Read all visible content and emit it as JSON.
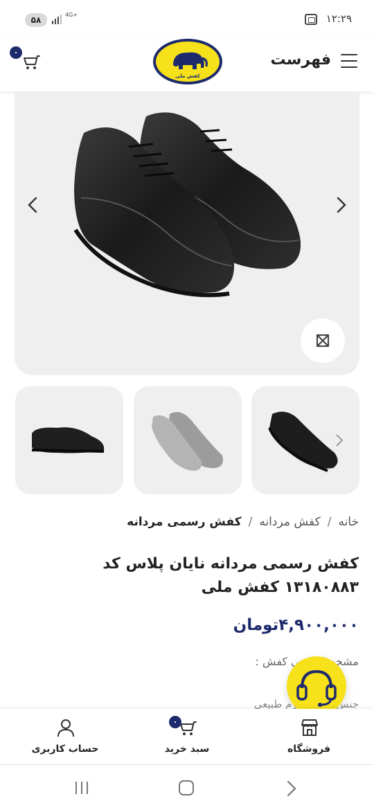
{
  "status_bar": {
    "time": "۱۲:۲۹",
    "battery": "۵۸",
    "network": "4G+"
  },
  "header": {
    "menu_label": "فهرست",
    "cart_count": "۰",
    "logo_text": "کفش ملی"
  },
  "breadcrumb": {
    "items": [
      "خانه",
      "کفش مردانه",
      "کفش رسمی مردانه"
    ]
  },
  "product": {
    "title": "کفش رسمی مردانه نایان پلاس کد ۱۳۱۸۰۸۸۳ کفش ملی",
    "price": "۴,۹۰۰,۰۰۰تومان",
    "spec_label": "مشخصات فنی کفش :",
    "spec_row": "جنس رویه : چرم طبیعی"
  },
  "bottom_nav": {
    "shop_label": "فروشگاه",
    "cart_label": "سبد خرید",
    "cart_badge": "۰",
    "account_label": "حساب کاربری"
  },
  "colors": {
    "accent": "#1d2a6b",
    "support_yellow": "#f6e11a",
    "image_bg": "#efefef"
  }
}
